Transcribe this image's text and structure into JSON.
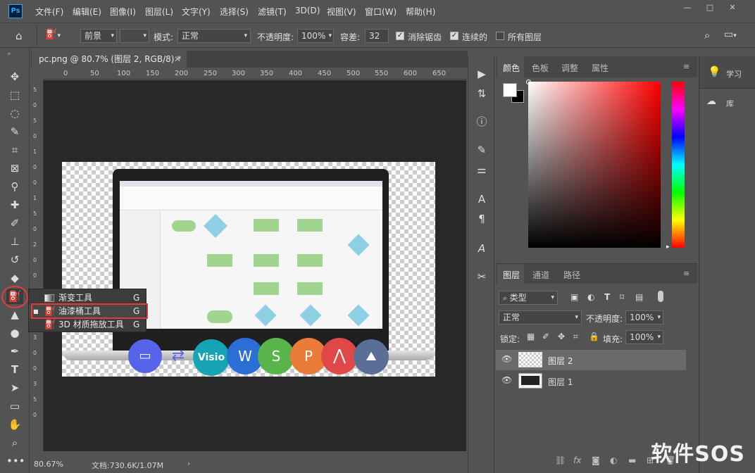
{
  "app": {
    "logo": "Ps"
  },
  "menu": [
    "文件(F)",
    "编辑(E)",
    "图像(I)",
    "图层(L)",
    "文字(Y)",
    "选择(S)",
    "滤镜(T)",
    "3D(D)",
    "视图(V)",
    "窗口(W)",
    "帮助(H)"
  ],
  "window_controls": {
    "minimize": "—",
    "restore": "□",
    "close": "✕"
  },
  "options": {
    "fill_source": "前景",
    "mode_label": "模式:",
    "mode_value": "正常",
    "opacity_label": "不透明度:",
    "opacity_value": "100%",
    "tolerance_label": "容差:",
    "tolerance_value": "32",
    "antialias_label": "消除锯齿",
    "contiguous_label": "连续的",
    "all_layers_label": "所有图层",
    "antialias_checked": true,
    "contiguous_checked": true,
    "all_layers_checked": false
  },
  "document": {
    "tab_title": "pc.png @ 80.7% (图层 2, RGB/8) *",
    "ruler_ticks": [
      "0",
      "50",
      "100",
      "150",
      "200",
      "250",
      "300",
      "350",
      "400",
      "450",
      "500",
      "550",
      "600",
      "650"
    ],
    "ruler_v_ticks": [
      "5",
      "0",
      "5",
      "0",
      "1",
      "0",
      "0",
      "1",
      "5",
      "0",
      "2",
      "0",
      "0",
      "2",
      "5",
      "0",
      "3",
      "0",
      "0",
      "3",
      "5",
      "0"
    ],
    "zoom": "80.67%",
    "doc_size": "文档:730.6K/1.07M"
  },
  "flyout": {
    "items": [
      {
        "label": "渐变工具",
        "shortcut": "G",
        "active": false
      },
      {
        "label": "油漆桶工具",
        "shortcut": "G",
        "active": true
      },
      {
        "label": "3D 材质拖放工具",
        "shortcut": "G",
        "active": false
      }
    ]
  },
  "image_content": {
    "apps": [
      "Visio",
      "W",
      "S",
      "P"
    ]
  },
  "color_panel": {
    "tabs": [
      "颜色",
      "色板",
      "调整",
      "属性"
    ],
    "active_tab": "颜色"
  },
  "layers_panel": {
    "tabs": [
      "图层",
      "通道",
      "路径"
    ],
    "filter_label": "类型",
    "blend_mode": "正常",
    "opacity_label": "不透明度:",
    "opacity_value": "100%",
    "lock_label": "锁定:",
    "fill_label": "填充:",
    "fill_value": "100%",
    "layers": [
      {
        "name": "图层 2",
        "selected": true
      },
      {
        "name": "图层 1",
        "selected": false
      }
    ]
  },
  "far_right": {
    "learn": "学习",
    "library": "库"
  },
  "watermark": "软件SOS",
  "colors": {
    "accent": "#31a8ff",
    "highlight_red": "#e23b3b",
    "panel_bg": "#535353",
    "canvas_bg": "#282828"
  }
}
